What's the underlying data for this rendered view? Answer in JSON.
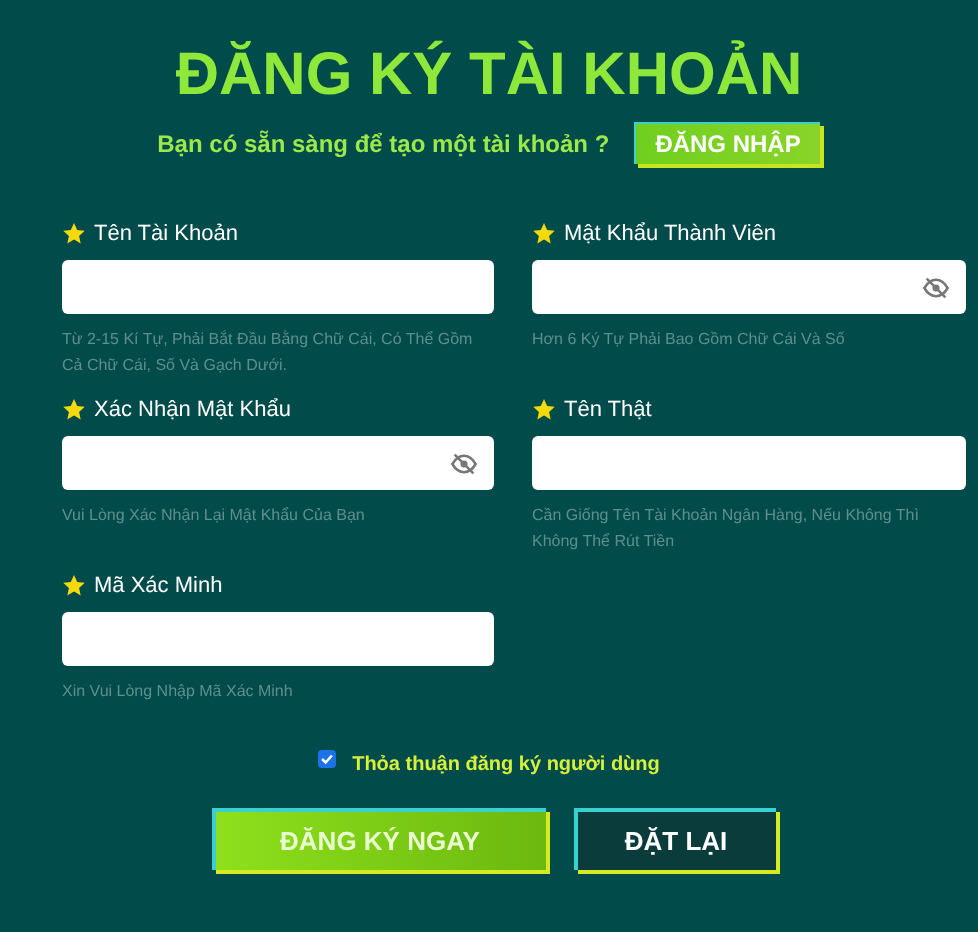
{
  "title": "ĐĂNG KÝ TÀI KHOẢN",
  "subtitle": "Bạn có sẵn sàng để tạo một tài khoản ?",
  "login_button": "ĐĂNG NHẬP",
  "fields": [
    {
      "label": "Tên Tài Khoản",
      "password_toggle": false,
      "hint": "Từ 2-15 Kí Tự, Phải Bắt Đầu Bằng Chữ Cái, Có Thể Gồm Cả Chữ Cái, Số Và Gạch Dưới."
    },
    {
      "label": "Mật Khẩu Thành Viên",
      "password_toggle": true,
      "hint": "Hơn 6 Ký Tự Phải Bao Gồm Chữ Cái Và Số"
    },
    {
      "label": "Xác Nhận Mật Khẩu",
      "password_toggle": true,
      "hint": "Vui Lòng Xác Nhận Lại Mật Khẩu Của Bạn"
    },
    {
      "label": "Tên Thật",
      "password_toggle": false,
      "hint": "Cần Giống Tên Tài Khoản Ngân Hàng, Nếu Không Thì Không Thể Rút Tiền"
    },
    {
      "label": "Mã Xác Minh",
      "password_toggle": false,
      "hint": "Xin Vui Lòng Nhập Mã Xác Minh"
    }
  ],
  "agreement": {
    "label": "Thỏa thuận đăng ký người dùng",
    "checked": true
  },
  "buttons": [
    {
      "label": "ĐĂNG KÝ NGAY",
      "kind": "primary"
    },
    {
      "label": "ĐẶT LẠI",
      "kind": "secondary"
    }
  ]
}
